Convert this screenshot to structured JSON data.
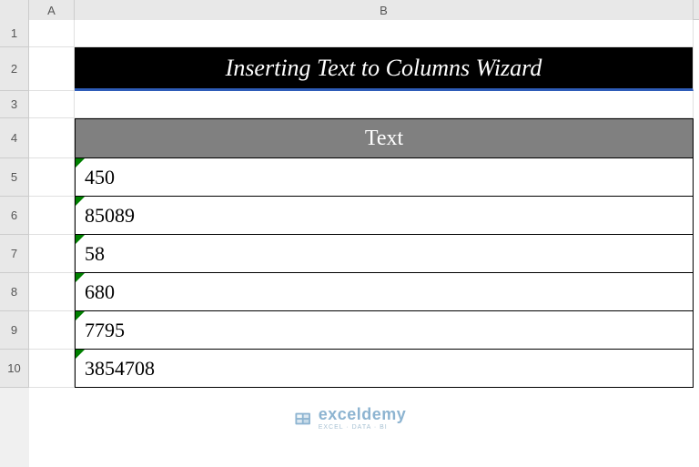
{
  "columns": {
    "A": "A",
    "B": "B"
  },
  "rows": [
    "1",
    "2",
    "3",
    "4",
    "5",
    "6",
    "7",
    "8",
    "9",
    "10"
  ],
  "title": "Inserting Text to Columns Wizard",
  "table": {
    "header": "Text",
    "values": [
      "450",
      "85089",
      "58",
      "680",
      "7795",
      "3854708"
    ]
  },
  "watermark": {
    "brand": "exceldemy",
    "sub": "EXCEL · DATA · BI"
  }
}
